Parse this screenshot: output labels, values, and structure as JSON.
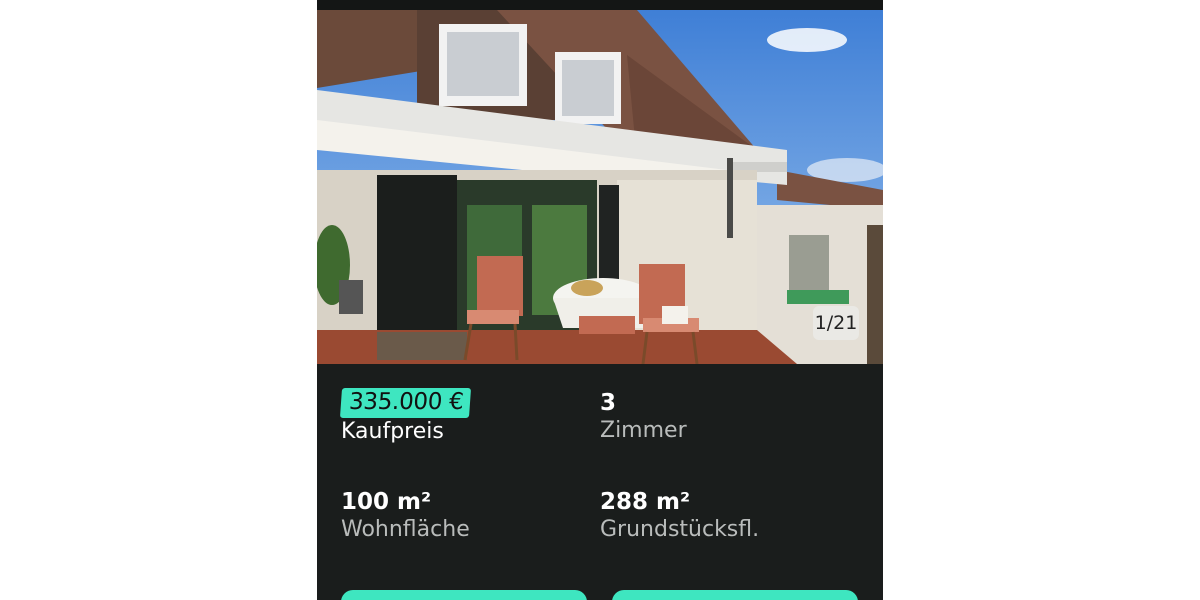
{
  "listing": {
    "photo_counter": "1/21",
    "price": "335.000 €",
    "price_label": "Kaufpreis",
    "rooms_value": "3",
    "rooms_label": "Zimmer",
    "living_area_value": "100 m²",
    "living_area_label": "Wohnfläche",
    "plot_area_value": "288 m²",
    "plot_area_label": "Grundstücksfl."
  },
  "colors": {
    "accent": "#3ee6c0",
    "panel_background": "#1a1d1c"
  }
}
